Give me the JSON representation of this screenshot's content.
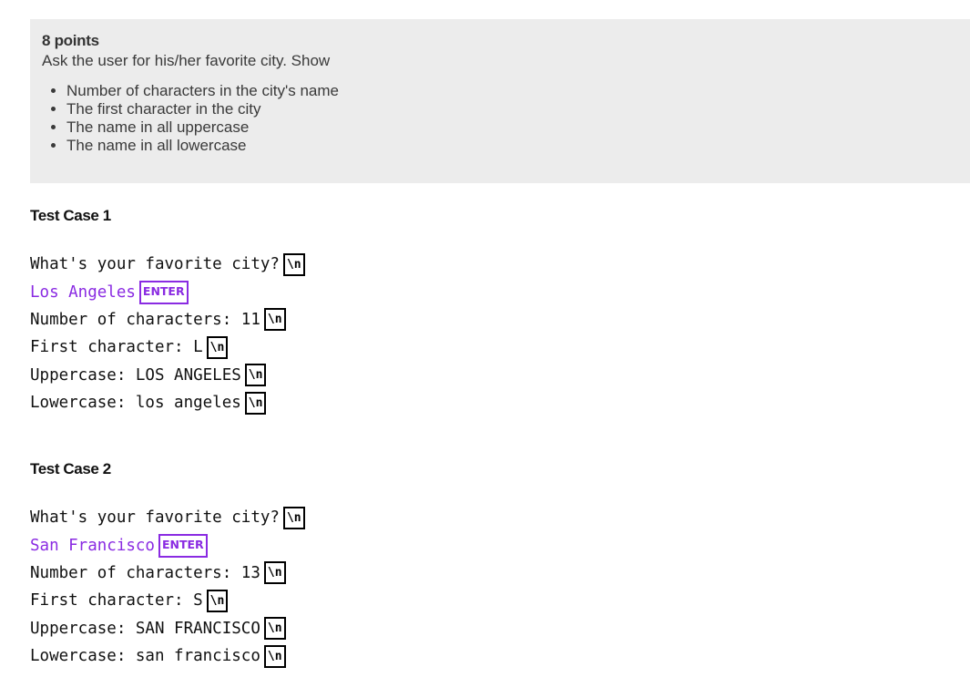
{
  "prompt": {
    "points": "8 points",
    "description": "Ask the user for his/her favorite city. Show",
    "requirements": [
      "Number of characters in the city's name",
      "The first character in the city",
      "The name in all uppercase",
      "The name in all lowercase"
    ]
  },
  "badges": {
    "newline": "\\n",
    "enter": "ENTER"
  },
  "colors": {
    "input_text": "#8a2be2",
    "prompt_background": "#ececec"
  },
  "test_cases": [
    {
      "title": "Test Case 1",
      "lines": [
        {
          "text": "What's your favorite city?",
          "type": "output"
        },
        {
          "text": "Los Angeles",
          "type": "input"
        },
        {
          "text": "Number of characters: 11",
          "type": "output"
        },
        {
          "text": "First character: L",
          "type": "output"
        },
        {
          "text": "Uppercase: LOS ANGELES",
          "type": "output"
        },
        {
          "text": "Lowercase: los angeles",
          "type": "output"
        }
      ]
    },
    {
      "title": "Test Case 2",
      "lines": [
        {
          "text": "What's your favorite city?",
          "type": "output"
        },
        {
          "text": "San Francisco",
          "type": "input"
        },
        {
          "text": "Number of characters: 13",
          "type": "output"
        },
        {
          "text": "First character: S",
          "type": "output"
        },
        {
          "text": "Uppercase: SAN FRANCISCO",
          "type": "output"
        },
        {
          "text": "Lowercase: san francisco",
          "type": "output"
        }
      ]
    }
  ]
}
